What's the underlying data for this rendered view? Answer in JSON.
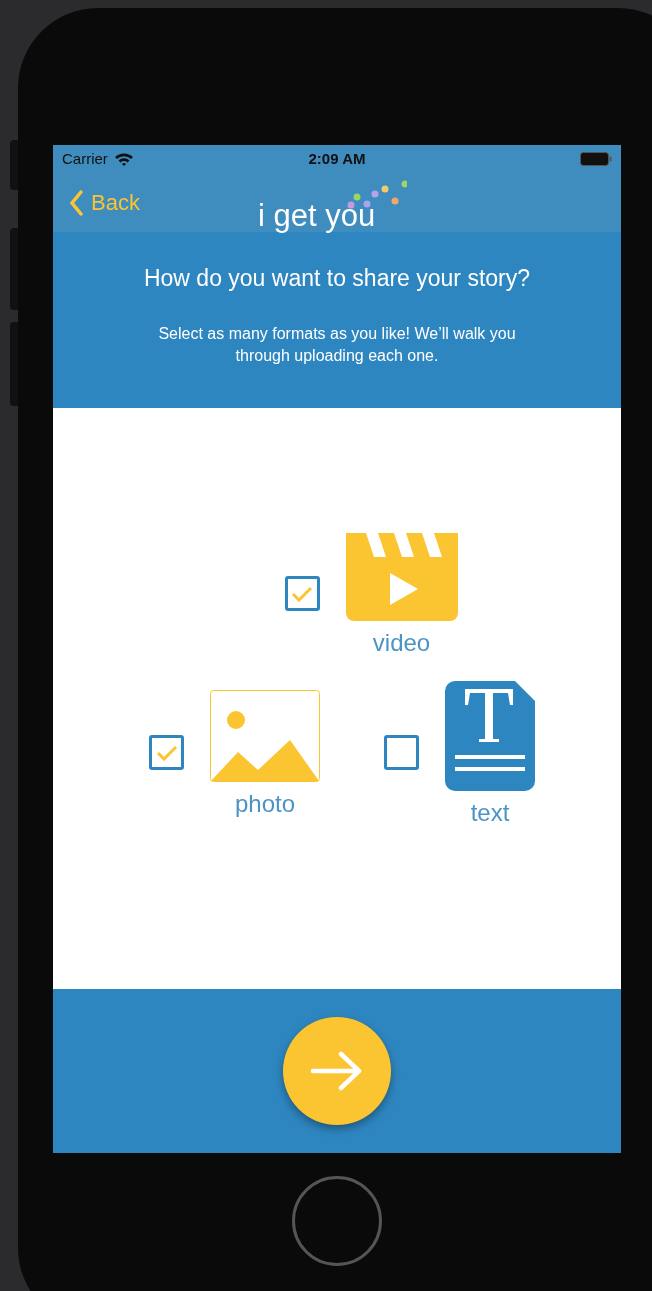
{
  "status_bar": {
    "carrier": "Carrier",
    "time": "2:09 AM"
  },
  "nav": {
    "back": "Back",
    "logo": "i get you"
  },
  "header": {
    "title": "How do you want to share your story?",
    "subtitle": "Select as many formats as you like! We’ll walk you through uploading each one."
  },
  "formats": [
    {
      "kind": "video",
      "label": "video",
      "checked": true
    },
    {
      "kind": "photo",
      "label": "photo",
      "checked": true
    },
    {
      "kind": "text",
      "label": "text",
      "checked": false
    }
  ]
}
